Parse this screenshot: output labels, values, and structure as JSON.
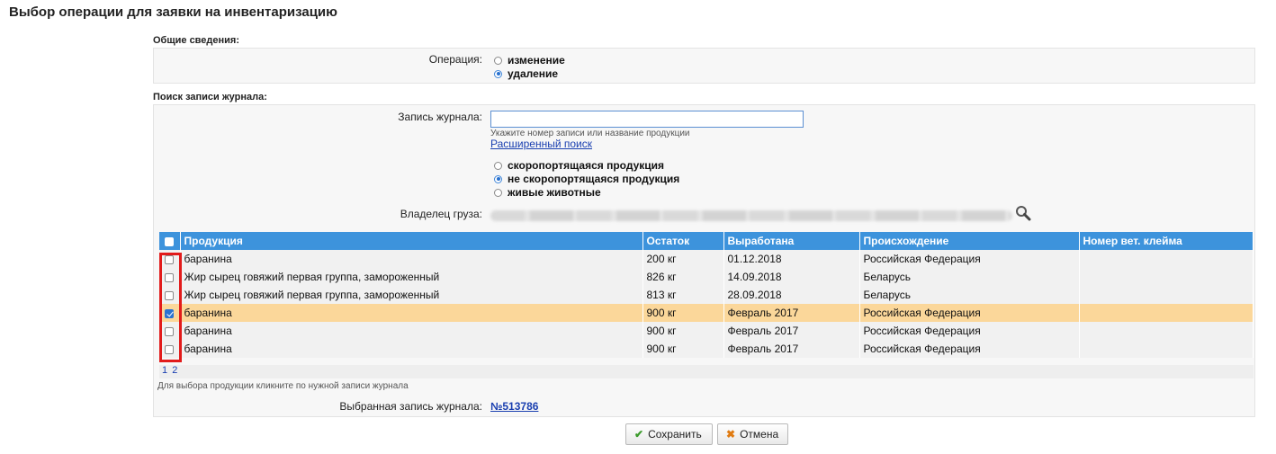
{
  "title": "Выбор операции для заявки на инвентаризацию",
  "general": {
    "section_label": "Общие сведения:",
    "operation_label": "Операция:",
    "operations": [
      {
        "label": "изменение",
        "selected": false
      },
      {
        "label": "удаление",
        "selected": true
      }
    ]
  },
  "search": {
    "section_label": "Поиск записи журнала:",
    "journal_label": "Запись журнала:",
    "journal_value": "",
    "journal_hint": "Укажите номер записи или название продукции",
    "advanced_link": "Расширенный поиск",
    "product_types": [
      {
        "label": "скоропортящаяся продукция",
        "selected": false
      },
      {
        "label": "не скоропортящаяся продукция",
        "selected": true
      },
      {
        "label": "живые животные",
        "selected": false
      }
    ],
    "owner_label": "Владелец груза:"
  },
  "table": {
    "columns": [
      "Продукция",
      "Остаток",
      "Выработана",
      "Происхождение",
      "Номер вет. клейма"
    ],
    "rows": [
      {
        "checked": false,
        "product": "баранина",
        "remainder": "200 кг",
        "produced": "01.12.2018",
        "origin": "Российская Федерация",
        "vet_mark": ""
      },
      {
        "checked": false,
        "product": "Жир сырец говяжий первая группа, замороженный",
        "remainder": "826 кг",
        "produced": "14.09.2018",
        "origin": "Беларусь",
        "vet_mark": ""
      },
      {
        "checked": false,
        "product": "Жир сырец говяжий первая группа, замороженный",
        "remainder": "813 кг",
        "produced": "28.09.2018",
        "origin": "Беларусь",
        "vet_mark": ""
      },
      {
        "checked": true,
        "product": "баранина",
        "remainder": "900 кг",
        "produced": "Февраль 2017",
        "origin": "Российская Федерация",
        "vet_mark": ""
      },
      {
        "checked": false,
        "product": "баранина",
        "remainder": "900 кг",
        "produced": "Февраль 2017",
        "origin": "Российская Федерация",
        "vet_mark": ""
      },
      {
        "checked": false,
        "product": "баранина",
        "remainder": "900 кг",
        "produced": "Февраль 2017",
        "origin": "Российская Федерация",
        "vet_mark": ""
      }
    ],
    "pages": [
      "1",
      "2"
    ],
    "footer_hint": "Для выбора продукции кликните по нужной записи журнала"
  },
  "selected": {
    "label": "Выбранная запись журнала:",
    "value": "№513786"
  },
  "buttons": {
    "save": "Сохранить",
    "cancel": "Отмена"
  },
  "colors": {
    "header_blue": "#3d93dc",
    "selected_row": "#fbd79a",
    "highlight_red": "#e21b1b",
    "save_icon_green": "#3a9a2a",
    "cancel_icon_orange": "#e07b12"
  },
  "icons": {
    "search": "magnifier-icon",
    "save": "checkmark-icon",
    "cancel": "cross-icon"
  }
}
